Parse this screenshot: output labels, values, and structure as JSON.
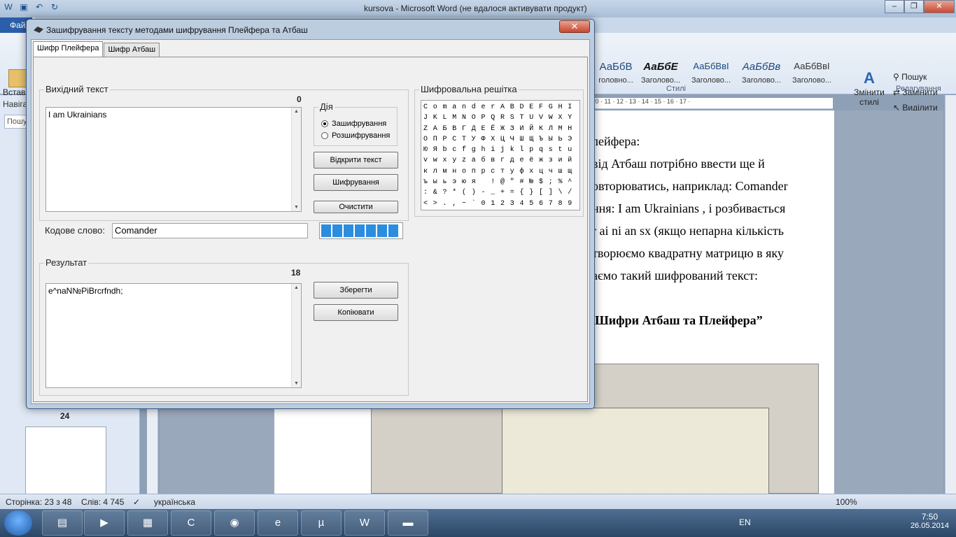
{
  "word": {
    "title": "kursova - Microsoft Word (не вдалося активувати продукт)",
    "file_tab": "Файл",
    "paste_label": "Встав",
    "styles": [
      {
        "sample": "АаБбВ",
        "name": "головно..."
      },
      {
        "sample": "АаБбЕ",
        "name": "Заголово..."
      },
      {
        "sample": "АаБбВвІ",
        "name": "Заголово..."
      },
      {
        "sample": "АаБбВв",
        "name": "Заголово..."
      },
      {
        "sample": "АаБбВвІ",
        "name": "Заголово..."
      }
    ],
    "styles_group": "Стилі",
    "change_styles": "Змінити стилі",
    "find": "Пошук",
    "replace": "Замінити",
    "select": "Виділити",
    "editing_group": "Редагування",
    "nav_title": "Навіга",
    "nav_search": "Пошу",
    "page_num": "24",
    "ruler_marks": "· 10 · 11 · 12 · 13 · 14 · 15 · 16 · 17 ·",
    "doc_lines": [
      "лейфера:",
      "від  Атбаш  потрібно  ввести  ще  й",
      "овторюватись, наприклад: Comander",
      "ння: I am Ukrainians , і розбивається",
      "r ai ni an sx (якщо непарна кількість",
      "творюємо квадратну матрицю в яку",
      "аємо   такий   шифрований   текст:"
    ],
    "doc_heading": "Шифри Атбаш та Плейфера”",
    "status": {
      "page": "Сторінка: 23 з 48",
      "words": "Слів: 4 745",
      "lang": "українська",
      "zoom": "100%"
    }
  },
  "taskbar": {
    "lang": "EN",
    "time": "7:50",
    "date": "26.05.2014"
  },
  "dialog": {
    "title": "Зашифрування тексту методами шифрування Плейфера та Атбаш",
    "tabs": [
      "Шифр Плейфера",
      "Шифр Атбаш"
    ],
    "source_group": "Вихідний текст",
    "source_count": "0",
    "source_text": "I am Ukrainians",
    "action_group": "Дія",
    "radio_encrypt": "Зашифрування",
    "radio_decrypt": "Розшифрування",
    "btn_open": "Відкрити текст",
    "btn_encrypt": "Шифрування",
    "btn_clear": "Очистити",
    "codeword_label": "Кодове слово:",
    "codeword_value": "Comander",
    "progress_percent": 100,
    "result_group": "Результат",
    "result_count": "18",
    "result_text": "e^naN№PiBrcrfndh;",
    "btn_save": "Зберегти",
    "btn_copy": "Копіювати",
    "grid_group": "Шифровальна решітка",
    "grid": [
      [
        "C",
        "o",
        "m",
        "a",
        "n",
        "d",
        "e",
        "r",
        "A",
        "B",
        "D",
        "E",
        "F",
        "G",
        "H",
        "I"
      ],
      [
        "J",
        "K",
        "L",
        "M",
        "N",
        "O",
        "P",
        "Q",
        "R",
        "S",
        "T",
        "U",
        "V",
        "W",
        "X",
        "Y"
      ],
      [
        "Z",
        "А",
        "Б",
        "В",
        "Г",
        "Д",
        "Е",
        "Ё",
        "Ж",
        "З",
        "И",
        "Й",
        "К",
        "Л",
        "М",
        "Н"
      ],
      [
        "О",
        "П",
        "Р",
        "С",
        "Т",
        "У",
        "Ф",
        "Х",
        "Ц",
        "Ч",
        "Ш",
        "Щ",
        "Ъ",
        "Ы",
        "Ь",
        "Э"
      ],
      [
        "Ю",
        "Я",
        "b",
        "c",
        "f",
        "g",
        "h",
        "i",
        "j",
        "k",
        "l",
        "p",
        "q",
        "s",
        "t",
        "u"
      ],
      [
        "v",
        "w",
        "x",
        "y",
        "z",
        "а",
        "б",
        "в",
        "г",
        "д",
        "е",
        "ё",
        "ж",
        "з",
        "и",
        "й"
      ],
      [
        "к",
        "л",
        "м",
        "н",
        "о",
        "п",
        "р",
        "с",
        "т",
        "у",
        "ф",
        "х",
        "ц",
        "ч",
        "ш",
        "щ"
      ],
      [
        "ъ",
        "ы",
        "ь",
        "э",
        "ю",
        "я",
        " ",
        "!",
        "@",
        "\"",
        "#",
        "№",
        "$",
        ";",
        "%",
        "^"
      ],
      [
        ":",
        "&",
        "?",
        "*",
        "(",
        ")",
        "-",
        "_",
        "+",
        "=",
        "{",
        "}",
        "[",
        "]",
        "\\",
        "/"
      ],
      [
        "<",
        ">",
        ".",
        ",",
        "~",
        "`",
        "0",
        "1",
        "2",
        "3",
        "4",
        "5",
        "6",
        "7",
        "8",
        "9"
      ]
    ]
  }
}
